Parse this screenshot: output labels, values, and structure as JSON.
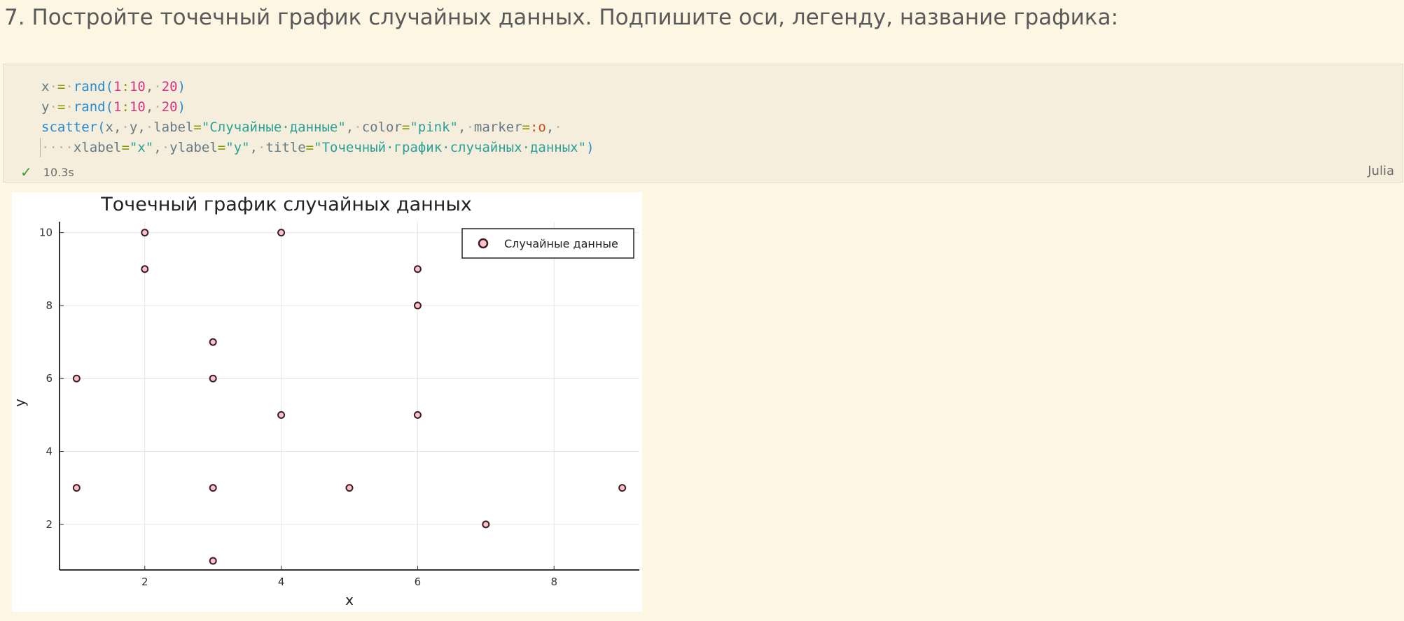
{
  "heading": "7. Постройте точечный график случайных данных. Подпишите оси, легенду, название графика:",
  "cell": {
    "code_lines": [
      [
        {
          "t": "x",
          "c": "t-plain"
        },
        {
          "t": "·",
          "c": "t-ws"
        },
        {
          "t": "=",
          "c": "t-op"
        },
        {
          "t": "·",
          "c": "t-ws"
        },
        {
          "t": "rand",
          "c": "t-fn"
        },
        {
          "t": "(",
          "c": "t-fn"
        },
        {
          "t": "1",
          "c": "t-num"
        },
        {
          "t": ":",
          "c": "t-op"
        },
        {
          "t": "10",
          "c": "t-num"
        },
        {
          "t": ",",
          "c": "t-plain"
        },
        {
          "t": "·",
          "c": "t-ws"
        },
        {
          "t": "20",
          "c": "t-num"
        },
        {
          "t": ")",
          "c": "t-fn"
        }
      ],
      [
        {
          "t": "y",
          "c": "t-plain"
        },
        {
          "t": "·",
          "c": "t-ws"
        },
        {
          "t": "=",
          "c": "t-op"
        },
        {
          "t": "·",
          "c": "t-ws"
        },
        {
          "t": "rand",
          "c": "t-fn"
        },
        {
          "t": "(",
          "c": "t-fn"
        },
        {
          "t": "1",
          "c": "t-num"
        },
        {
          "t": ":",
          "c": "t-op"
        },
        {
          "t": "10",
          "c": "t-num"
        },
        {
          "t": ",",
          "c": "t-plain"
        },
        {
          "t": "·",
          "c": "t-ws"
        },
        {
          "t": "20",
          "c": "t-num"
        },
        {
          "t": ")",
          "c": "t-fn"
        }
      ],
      [
        {
          "t": "scatter",
          "c": "t-fn"
        },
        {
          "t": "(",
          "c": "t-fn"
        },
        {
          "t": "x,",
          "c": "t-plain"
        },
        {
          "t": "·",
          "c": "t-ws"
        },
        {
          "t": "y,",
          "c": "t-plain"
        },
        {
          "t": "·",
          "c": "t-ws"
        },
        {
          "t": "label",
          "c": "t-plain"
        },
        {
          "t": "=",
          "c": "t-op"
        },
        {
          "t": "\"Случайные·данные\"",
          "c": "t-str"
        },
        {
          "t": ",",
          "c": "t-plain"
        },
        {
          "t": "·",
          "c": "t-ws"
        },
        {
          "t": "color",
          "c": "t-plain"
        },
        {
          "t": "=",
          "c": "t-op"
        },
        {
          "t": "\"pink\"",
          "c": "t-str"
        },
        {
          "t": ",",
          "c": "t-plain"
        },
        {
          "t": "·",
          "c": "t-ws"
        },
        {
          "t": "marker",
          "c": "t-plain"
        },
        {
          "t": "=",
          "c": "t-op"
        },
        {
          "t": ":o",
          "c": "t-sym"
        },
        {
          "t": ",",
          "c": "t-plain"
        },
        {
          "t": "·",
          "c": "t-ws"
        }
      ],
      [
        {
          "t": "·",
          "c": "t-ws"
        },
        {
          "t": "·",
          "c": "t-ws"
        },
        {
          "t": "·",
          "c": "t-ws"
        },
        {
          "t": "·",
          "c": "t-ws"
        },
        {
          "t": "xlabel",
          "c": "t-plain"
        },
        {
          "t": "=",
          "c": "t-op"
        },
        {
          "t": "\"x\"",
          "c": "t-str"
        },
        {
          "t": ",",
          "c": "t-plain"
        },
        {
          "t": "·",
          "c": "t-ws"
        },
        {
          "t": "ylabel",
          "c": "t-plain"
        },
        {
          "t": "=",
          "c": "t-op"
        },
        {
          "t": "\"y\"",
          "c": "t-str"
        },
        {
          "t": ",",
          "c": "t-plain"
        },
        {
          "t": "·",
          "c": "t-ws"
        },
        {
          "t": "title",
          "c": "t-plain"
        },
        {
          "t": "=",
          "c": "t-op"
        },
        {
          "t": "\"Точечный·график·случайных·данных\"",
          "c": "t-str"
        },
        {
          "t": ")",
          "c": "t-fn"
        }
      ]
    ],
    "status_time": "10.3s",
    "status_icon": "check-icon",
    "language": "Julia"
  },
  "chart_data": {
    "type": "scatter",
    "title": "Точечный график случайных данных",
    "xlabel": "x",
    "ylabel": "y",
    "xlim": [
      0.75,
      9.25
    ],
    "ylim": [
      0.75,
      10.3
    ],
    "xticks": [
      2,
      4,
      6,
      8
    ],
    "yticks": [
      2,
      4,
      6,
      8,
      10
    ],
    "grid": true,
    "legend_position": "top-right",
    "series": [
      {
        "name": "Случайные данные",
        "color": "#ffc0cb",
        "edge_color": "#3a1f24",
        "points": [
          [
            1,
            6
          ],
          [
            1,
            3
          ],
          [
            2,
            10
          ],
          [
            2,
            9
          ],
          [
            3,
            7
          ],
          [
            3,
            6
          ],
          [
            3,
            3
          ],
          [
            3,
            1
          ],
          [
            4,
            10
          ],
          [
            4,
            5
          ],
          [
            5,
            3
          ],
          [
            6,
            9
          ],
          [
            6,
            8
          ],
          [
            6,
            5
          ],
          [
            7,
            2
          ],
          [
            9,
            3
          ]
        ]
      }
    ]
  }
}
